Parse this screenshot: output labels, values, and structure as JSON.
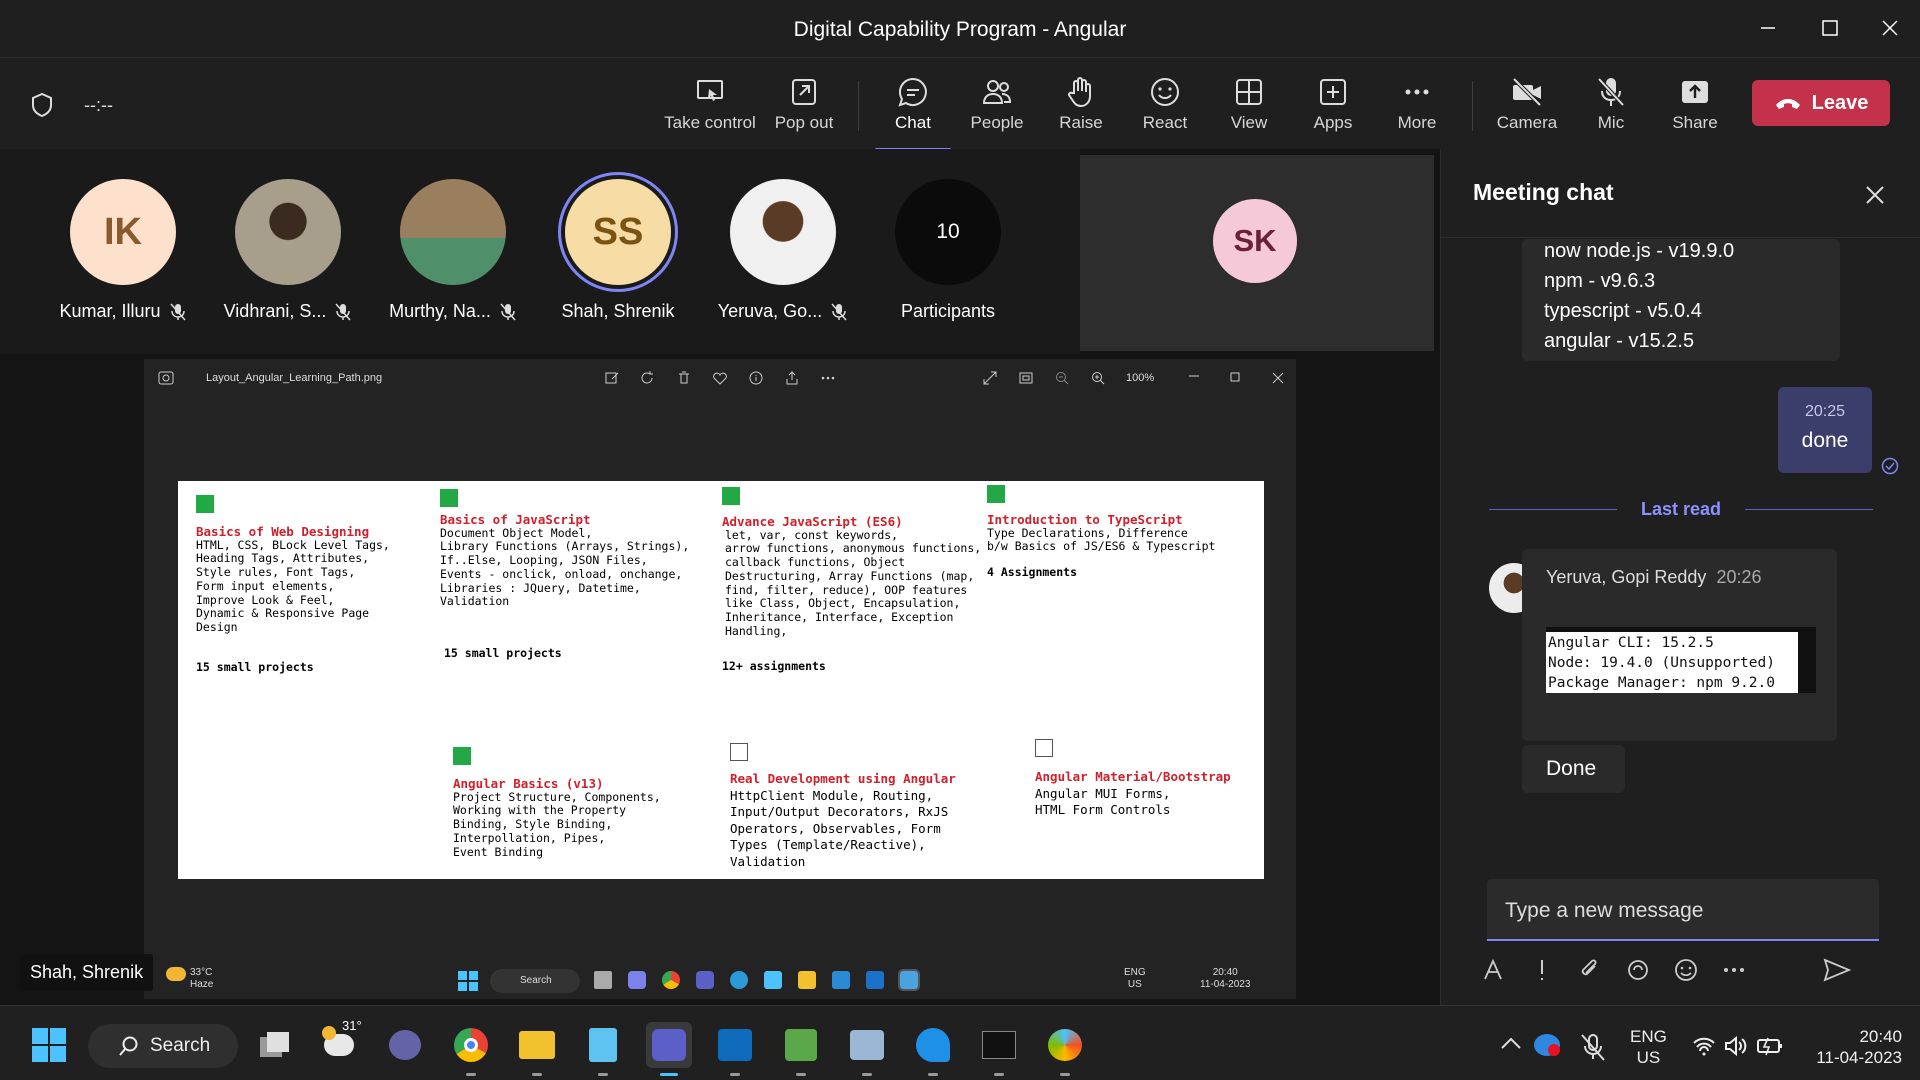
{
  "window": {
    "title": "Digital Capability Program - Angular"
  },
  "meeting": {
    "timer": "--:--",
    "toolbar": [
      {
        "label": "Take control",
        "icon": "take-control-icon"
      },
      {
        "label": "Pop out",
        "icon": "pop-out-icon"
      },
      {
        "label": "Chat",
        "icon": "chat-icon"
      },
      {
        "label": "People",
        "icon": "people-icon"
      },
      {
        "label": "Raise",
        "icon": "raise-hand-icon"
      },
      {
        "label": "React",
        "icon": "react-icon"
      },
      {
        "label": "View",
        "icon": "view-icon"
      },
      {
        "label": "Apps",
        "icon": "apps-icon"
      },
      {
        "label": "More",
        "icon": "more-icon"
      },
      {
        "label": "Camera",
        "icon": "camera-off-icon"
      },
      {
        "label": "Mic",
        "icon": "mic-off-icon"
      },
      {
        "label": "Share",
        "icon": "share-icon"
      }
    ],
    "leave_label": "Leave",
    "colors": {
      "accent": "#7f85f5",
      "leave": "#c4314b",
      "green_check": "#22a845",
      "heading_red": "#d0202a"
    }
  },
  "participants": [
    {
      "initials": "IK",
      "name": "Kumar, Illuru",
      "muted": true
    },
    {
      "initials": "",
      "name": "Vidhrani, S...",
      "muted": true
    },
    {
      "initials": "",
      "name": "Murthy, Na...",
      "muted": true
    },
    {
      "initials": "SS",
      "name": "Shah, Shrenik",
      "muted": false
    },
    {
      "initials": "",
      "name": "Yeruva, Go...",
      "muted": true
    }
  ],
  "participant_count": {
    "count": "10",
    "label": "Participants"
  },
  "spotlight": {
    "initials": "SK"
  },
  "presenter_name": "Shah, Shrenik",
  "viewer": {
    "filename": "Layout_Angular_Learning_Path.png",
    "zoom": "100%"
  },
  "learning_path": {
    "blocks": [
      {
        "heading": "Basics of Web Designing",
        "body": "HTML, CSS, BLock Level Tags,\nHeading Tags, Attributes,\nStyle rules, Font Tags,\nForm input elements,\nImprove Look & Feel,\nDynamic & Responsive Page Design",
        "footer": "15 small projects",
        "checked": true
      },
      {
        "heading": "Basics of JavaScript",
        "body": "Document Object Model,\nLibrary Functions (Arrays, Strings),\nIf..Else, Looping, JSON Files,\nEvents - onclick, onload, onchange,\nLibraries : JQuery, Datetime, Validation",
        "footer": "15 small projects",
        "checked": true
      },
      {
        "heading": "Advance JavaScript (ES6)",
        "body": "let, var, const keywords,\narrow functions, anonymous functions,\ncallback functions, Object\nDestructuring, Array Functions (map,\nfind, filter, reduce), OOP features\nlike Class, Object, Encapsulation,\nInheritance, Interface, Exception\nHandling,",
        "footer": "12+ assignments",
        "checked": true
      },
      {
        "heading": "Introduction to TypeScript",
        "body": "Type Declarations, Difference\nb/w Basics of JS/ES6 & Typescript",
        "footer": "4 Assignments",
        "checked": true
      },
      {
        "heading": "Angular Basics (v13)",
        "body": "Project Structure, Components,\nWorking with the Property\nBinding, Style Binding,\nInterpollation, Pipes,\nEvent Binding",
        "footer": "",
        "checked": true
      },
      {
        "heading": "Real Development using Angular",
        "body": "HttpClient Module, Routing,\nInput/Output Decorators, RxJS\nOperators, Observables, Form\nTypes (Template/Reactive),\nValidation",
        "footer": "",
        "checked": false
      },
      {
        "heading": "Angular Material/Bootstrap",
        "body": "Angular MUI Forms,\nHTML Form Controls",
        "footer": "",
        "checked": false
      }
    ]
  },
  "mini_taskbar": {
    "weather_temp": "33°C",
    "weather_desc": "Haze",
    "search": "Search",
    "lang": "ENG",
    "region": "US",
    "time": "20:40",
    "date": "11-04-2023"
  },
  "chat": {
    "title": "Meeting chat",
    "version_lines": [
      "now node.js - v19.9.0",
      "npm -  v9.6.3",
      "typescript - v5.0.4",
      "angular - v15.2.5"
    ],
    "my_message": {
      "time": "20:25",
      "text": "done"
    },
    "last_read": "Last read",
    "gopi": {
      "sender": "Yeruva, Gopi Reddy",
      "time": "20:26",
      "code": [
        "Angular CLI: 15.2.5",
        "Node: 19.4.0 (Unsupported)",
        "Package Manager: npm 9.2.0"
      ],
      "followup": "Done"
    },
    "compose_placeholder": "Type a new message"
  },
  "taskbar": {
    "search": "Search",
    "weather_temp": "31°",
    "lang": "ENG",
    "region": "US",
    "time": "20:40",
    "date": "11-04-2023"
  }
}
